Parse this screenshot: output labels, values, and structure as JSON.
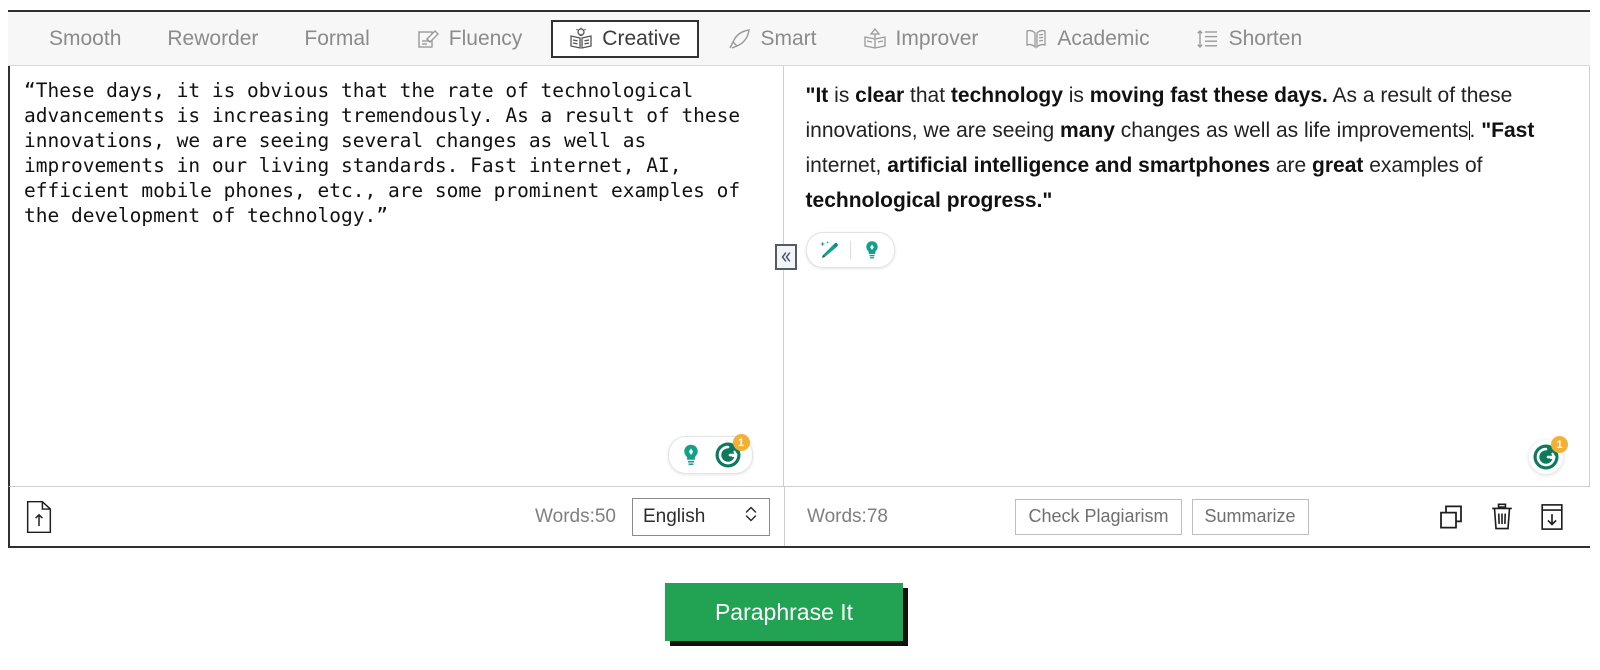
{
  "toolbar": {
    "tabs": [
      {
        "label": "Smooth",
        "icon": "none",
        "selected": false
      },
      {
        "label": "Reworder",
        "icon": "none",
        "selected": false
      },
      {
        "label": "Formal",
        "icon": "none",
        "selected": false
      },
      {
        "label": "Fluency",
        "icon": "document-pencil-icon",
        "selected": false
      },
      {
        "label": "Creative",
        "icon": "book-lightbulb-icon",
        "selected": true
      },
      {
        "label": "Smart",
        "icon": "quill-pen-icon",
        "selected": false
      },
      {
        "label": "Improver",
        "icon": "book-arrow-up-icon",
        "selected": false
      },
      {
        "label": "Academic",
        "icon": "open-book-icon",
        "selected": false
      },
      {
        "label": "Shorten",
        "icon": "line-spacing-icon",
        "selected": false
      }
    ]
  },
  "editor": {
    "source": {
      "text": "“These days, it is obvious that the rate of technological advancements is increasing tremendously. As a result of these innovations, we are seeing several changes as well as improvements in our living standards. Fast internet, AI, efficient mobile phones, etc., are some prominent examples of the development of technology.”",
      "word_count_label": "Words:50",
      "upload_icon": "file-upload-icon",
      "language": {
        "selected": "English",
        "options": [
          "English"
        ]
      },
      "assist": {
        "lightbulb_icon": "lightbulb-icon",
        "grammarly_icon": "grammarly-icon",
        "grammarly_badge": "1"
      }
    },
    "output": {
      "segments": [
        {
          "text": "\"It",
          "bold": true
        },
        {
          "text": " is ",
          "bold": false
        },
        {
          "text": "clear",
          "bold": true
        },
        {
          "text": " that ",
          "bold": false
        },
        {
          "text": "technology",
          "bold": true
        },
        {
          "text": " is ",
          "bold": false
        },
        {
          "text": "moving fast these days.",
          "bold": true
        },
        {
          "text": " As a result of these innovations, we are seeing ",
          "bold": false
        },
        {
          "text": "many",
          "bold": true
        },
        {
          "text": " changes as well as life improvements",
          "bold": false
        },
        {
          "text": "caret",
          "bold": false
        },
        {
          "text": ". ",
          "bold": false
        },
        {
          "text": "\"Fast",
          "bold": true
        },
        {
          "text": " internet, ",
          "bold": false
        },
        {
          "text": "artificial intelligence and smartphones",
          "bold": true
        },
        {
          "text": " are ",
          "bold": false
        },
        {
          "text": "great",
          "bold": true
        },
        {
          "text": " examples of ",
          "bold": false
        },
        {
          "text": "technological progress.\"",
          "bold": true
        }
      ],
      "word_count_label": "Words:78",
      "check_plagiarism_label": "Check Plagiarism",
      "summarize_label": "Summarize",
      "copy_icon": "copy-icon",
      "delete_icon": "trash-icon",
      "download_icon": "download-icon",
      "inline_tools": {
        "rewrite_icon": "magic-pencil-icon",
        "idea_icon": "lightbulb-icon"
      },
      "assist": {
        "grammarly_icon": "grammarly-icon",
        "grammarly_badge": "1"
      }
    },
    "collapse_handle_icon": "chevron-double-left-icon"
  },
  "cta": {
    "label": "Paraphrase It"
  },
  "colors": {
    "brand_green": "#22a353",
    "teal": "#12a08a",
    "grammarly_green": "#0d7a5f",
    "badge_orange": "#f2b035",
    "tab_text": "#8b8b8b",
    "border_dark": "#2f2f2f"
  }
}
